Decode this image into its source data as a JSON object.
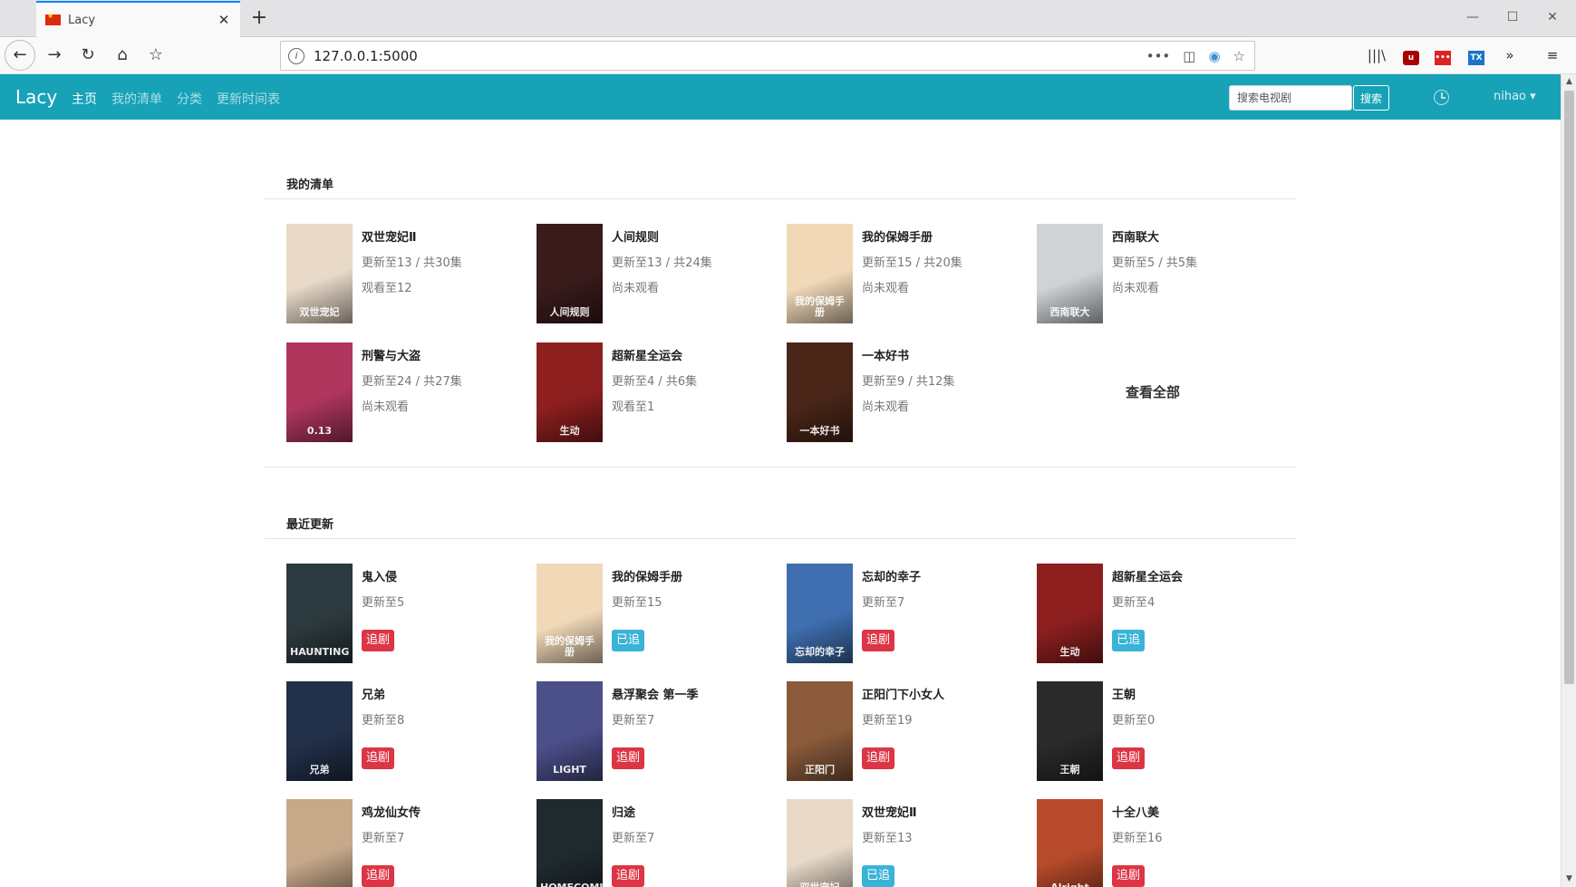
{
  "browser": {
    "tab_title": "Lacy",
    "new_tab": "+",
    "url": "127.0.0.1:5000",
    "url_more": "•••",
    "minimize": "—",
    "maximize": "☐",
    "close": "✕"
  },
  "site": {
    "brand": "Lacy",
    "nav": [
      "主页",
      "我的清单",
      "分类",
      "更新时间表"
    ],
    "search_placeholder": "搜索电视剧",
    "search_button": "搜索",
    "user": "nihao ▾",
    "accent": "#17a2b8"
  },
  "my_list": {
    "title": "我的清单",
    "view_all": "查看全部",
    "items": [
      {
        "title": "双世宠妃Ⅱ",
        "update": "更新至13 / 共30集",
        "watch": "观看至12",
        "color": "#e8d9c8",
        "poster_text": "双世宠妃"
      },
      {
        "title": "人间规则",
        "update": "更新至13 / 共24集",
        "watch": "尚未观看",
        "color": "#3a1b1b",
        "poster_text": "人间规则"
      },
      {
        "title": "我的保姆手册",
        "update": "更新至15 / 共20集",
        "watch": "尚未观看",
        "color": "#f1d9b8",
        "poster_text": "我的保姆手册"
      },
      {
        "title": "西南联大",
        "update": "更新至5 / 共5集",
        "watch": "尚未观看",
        "color": "#cfd3d6",
        "poster_text": "西南联大"
      },
      {
        "title": "刑警与大盗",
        "update": "更新至24 / 共27集",
        "watch": "尚未观看",
        "color": "#b0365e",
        "poster_text": "0.13"
      },
      {
        "title": "超新星全运会",
        "update": "更新至4 / 共6集",
        "watch": "观看至1",
        "color": "#8e1f1f",
        "poster_text": "生动"
      },
      {
        "title": "一本好书",
        "update": "更新至9 / 共12集",
        "watch": "尚未观看",
        "color": "#4a2618",
        "poster_text": "一本好书"
      }
    ]
  },
  "recent": {
    "title": "最近更新",
    "items": [
      {
        "title": "鬼入侵",
        "update": "更新至5",
        "tag": "追剧",
        "tag_color": "red",
        "color": "#2c3a3f",
        "poster_text": "HAUNTING"
      },
      {
        "title": "我的保姆手册",
        "update": "更新至15",
        "tag": "已追",
        "tag_color": "blue",
        "color": "#f1d9b8",
        "poster_text": "我的保姆手册"
      },
      {
        "title": "忘却的幸子",
        "update": "更新至7",
        "tag": "追剧",
        "tag_color": "red",
        "color": "#3f6fb0",
        "poster_text": "忘却的幸子"
      },
      {
        "title": "超新星全运会",
        "update": "更新至4",
        "tag": "已追",
        "tag_color": "blue",
        "color": "#8e1f1f",
        "poster_text": "生动"
      },
      {
        "title": "兄弟",
        "update": "更新至8",
        "tag": "追剧",
        "tag_color": "red",
        "color": "#22304a",
        "poster_text": "兄弟"
      },
      {
        "title": "悬浮聚会 第一季",
        "update": "更新至7",
        "tag": "追剧",
        "tag_color": "red",
        "color": "#4b4f8a",
        "poster_text": "LIGHT"
      },
      {
        "title": "正阳门下小女人",
        "update": "更新至19",
        "tag": "追剧",
        "tag_color": "red",
        "color": "#8a5a3a",
        "poster_text": "正阳门"
      },
      {
        "title": "王朝",
        "update": "更新至0",
        "tag": "追剧",
        "tag_color": "red",
        "color": "#2a2a2a",
        "poster_text": "王朝"
      },
      {
        "title": "鸡龙仙女传",
        "update": "更新至7",
        "tag": "追剧",
        "tag_color": "red",
        "color": "#c7a98a",
        "poster_text": ""
      },
      {
        "title": "归途",
        "update": "更新至7",
        "tag": "追剧",
        "tag_color": "red",
        "color": "#1f2a2e",
        "poster_text": "HOMECOMING"
      },
      {
        "title": "双世宠妃Ⅱ",
        "update": "更新至13",
        "tag": "已追",
        "tag_color": "blue",
        "color": "#e8d9c8",
        "poster_text": "双世宠妃"
      },
      {
        "title": "十全八美",
        "update": "更新至16",
        "tag": "追剧",
        "tag_color": "red",
        "color": "#b74a2a",
        "poster_text": "Alright"
      }
    ]
  }
}
